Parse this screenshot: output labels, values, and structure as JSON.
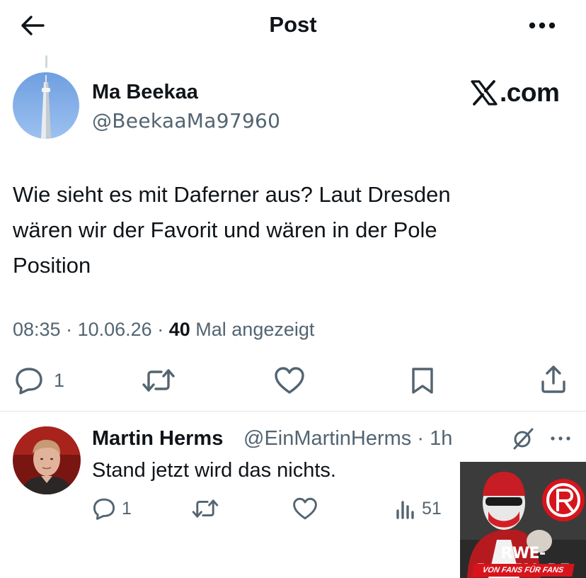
{
  "header": {
    "title": "Post",
    "back_icon": "arrow-left-icon",
    "more_icon": "ellipsis-icon"
  },
  "post": {
    "author_name": "Ma Beekaa",
    "author_handle": "@BeekaaMa97960",
    "text": "Wie sieht es mit Daferner aus? Laut Dresden\nwären wir der Favorit und wären in der Pole\nPosition",
    "time": "08:35",
    "date": "10.06.26",
    "views_count": "40",
    "views_label": "Mal angezeigt",
    "reply_count": "1",
    "brand_text": ".com"
  },
  "reply": {
    "author_name": "Martin Herms",
    "author_handle": "@EinMartinHerms",
    "age": "1h",
    "text": "Stand jetzt wird das nichts.",
    "reply_count": "1",
    "views_count": "51"
  },
  "watermark": {
    "title": "RWE-PORTAL.DE",
    "subtitle": "VON FANS FÜR FANS",
    "logo_letters": "RWE"
  },
  "colors": {
    "text_primary": "#0f1419",
    "text_secondary": "#536471",
    "divider": "#dfe4e8",
    "watermark_red": "#d7141c"
  }
}
